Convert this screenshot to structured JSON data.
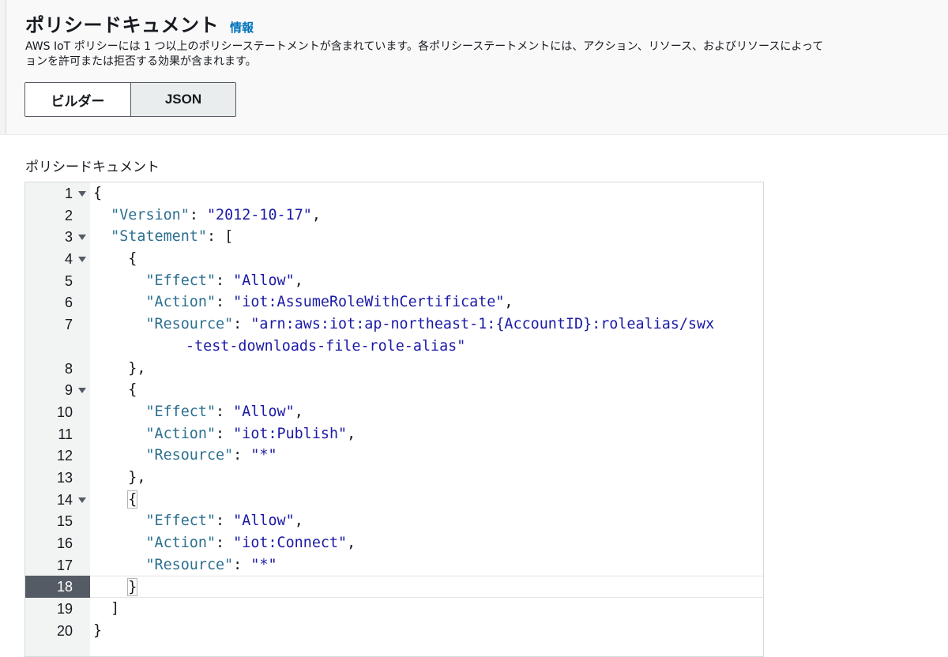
{
  "header": {
    "title": "ポリシードキュメント",
    "info_link": "情報",
    "description_line1": "AWS IoT ポリシーには 1 つ以上のポリシーステートメントが含まれています。各ポリシーステートメントには、アクション、リソース、およびリソースによって",
    "description_line2": "ョンを許可または拒否する効果が含まれます。"
  },
  "mode_toggle": {
    "builder_label": "ビルダー",
    "json_label": "JSON",
    "selected": "JSON"
  },
  "editor": {
    "label": "ポリシードキュメント",
    "active_line": 18,
    "lines": [
      {
        "n": "1",
        "fold": true
      },
      {
        "n": "2",
        "fold": false
      },
      {
        "n": "3",
        "fold": true
      },
      {
        "n": "4",
        "fold": true
      },
      {
        "n": "5",
        "fold": false
      },
      {
        "n": "6",
        "fold": false
      },
      {
        "n": "7",
        "fold": false
      },
      {
        "n": "8",
        "fold": false
      },
      {
        "n": "9",
        "fold": true
      },
      {
        "n": "10",
        "fold": false
      },
      {
        "n": "11",
        "fold": false
      },
      {
        "n": "12",
        "fold": false
      },
      {
        "n": "13",
        "fold": false
      },
      {
        "n": "14",
        "fold": true
      },
      {
        "n": "15",
        "fold": false
      },
      {
        "n": "16",
        "fold": false
      },
      {
        "n": "17",
        "fold": false
      },
      {
        "n": "18",
        "fold": false
      },
      {
        "n": "19",
        "fold": false
      },
      {
        "n": "20",
        "fold": false
      }
    ],
    "code": {
      "l1": "{",
      "l2_key": "\"Version\"",
      "l2_val": "\"2012-10-17\"",
      "l3_key": "\"Statement\"",
      "l3_rest": ": [",
      "l4": "{",
      "effect_key": "\"Effect\"",
      "allow_val": "\"Allow\"",
      "action_key": "\"Action\"",
      "resource_key": "\"Resource\"",
      "l6_val": "\"iot:AssumeRoleWithCertificate\"",
      "l7_val_part1": "\"arn:aws:iot:ap-northeast-1:{AccountID}:rolealias/swx",
      "l7_val_part2": "-test-downloads-file-role-alias\"",
      "l8": "},",
      "l9": "{",
      "l11_val": "\"iot:Publish\"",
      "star_val": "\"*\"",
      "l13": "},",
      "l14": "{",
      "l16_val": "\"iot:Connect\"",
      "l18": "}",
      "l19": "]",
      "l20": "}"
    }
  }
}
